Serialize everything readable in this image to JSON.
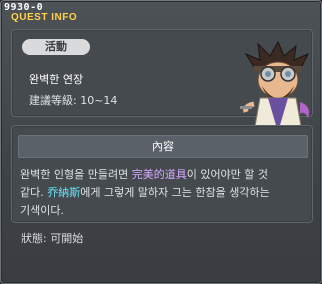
{
  "window": {
    "code": "9930-0",
    "title": "QUEST INFO"
  },
  "quest": {
    "category": "活動",
    "name": "완벽한 연장",
    "level": "建議等級: 10~14"
  },
  "content": {
    "header": "內容",
    "line1_a": "완벽한 인형을 만들려면 ",
    "line1_item": "完美的道具",
    "line1_b": "이 있어야만 할 것",
    "line2_a": "같다. ",
    "line2_npc": "乔納斯",
    "line2_b": "에게 그렇게 말하자 그는 한참을 생각하는",
    "line3": "기색이다."
  },
  "status": {
    "label": "狀態:",
    "value": "可開始"
  },
  "colors": {
    "highlight_item": "#d7a8ff",
    "highlight_npc": "#6ae6ff",
    "title": "#ffd24a"
  },
  "icons": {
    "character": "npc-portrait"
  }
}
